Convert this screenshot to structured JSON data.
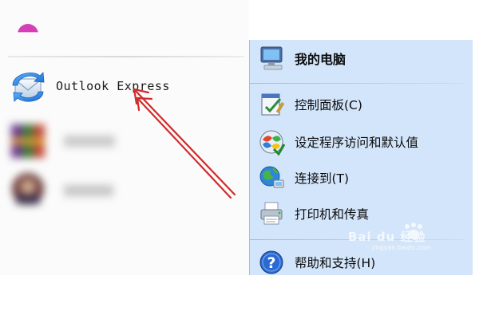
{
  "left_menu": {
    "pinned": [
      {
        "label": "Outlook Express",
        "icon": "outlook-express-icon"
      }
    ],
    "recent": [
      {
        "label": "",
        "icon": "blurred-app-icon"
      },
      {
        "label": "",
        "icon": "blurred-app-icon"
      }
    ]
  },
  "right_menu": {
    "items": [
      {
        "label": "我的电脑",
        "icon": "my-computer-icon",
        "bold": true
      },
      {
        "label": "控制面板(C)",
        "icon": "control-panel-icon"
      },
      {
        "label": "设定程序访问和默认值",
        "icon": "program-access-icon"
      },
      {
        "label": "连接到(T)",
        "icon": "connect-to-icon"
      },
      {
        "label": "打印机和传真",
        "icon": "printer-fax-icon"
      },
      {
        "label": "帮助和支持(H)",
        "icon": "help-support-icon"
      }
    ]
  },
  "watermark": {
    "text": "Bai du 经验",
    "sub": "jingyan.baidu.com"
  },
  "colors": {
    "right_pane_bg": "#d3e5fa",
    "arrow_red": "#d12b2b",
    "left_pane_bg": "#fbfbfb"
  }
}
